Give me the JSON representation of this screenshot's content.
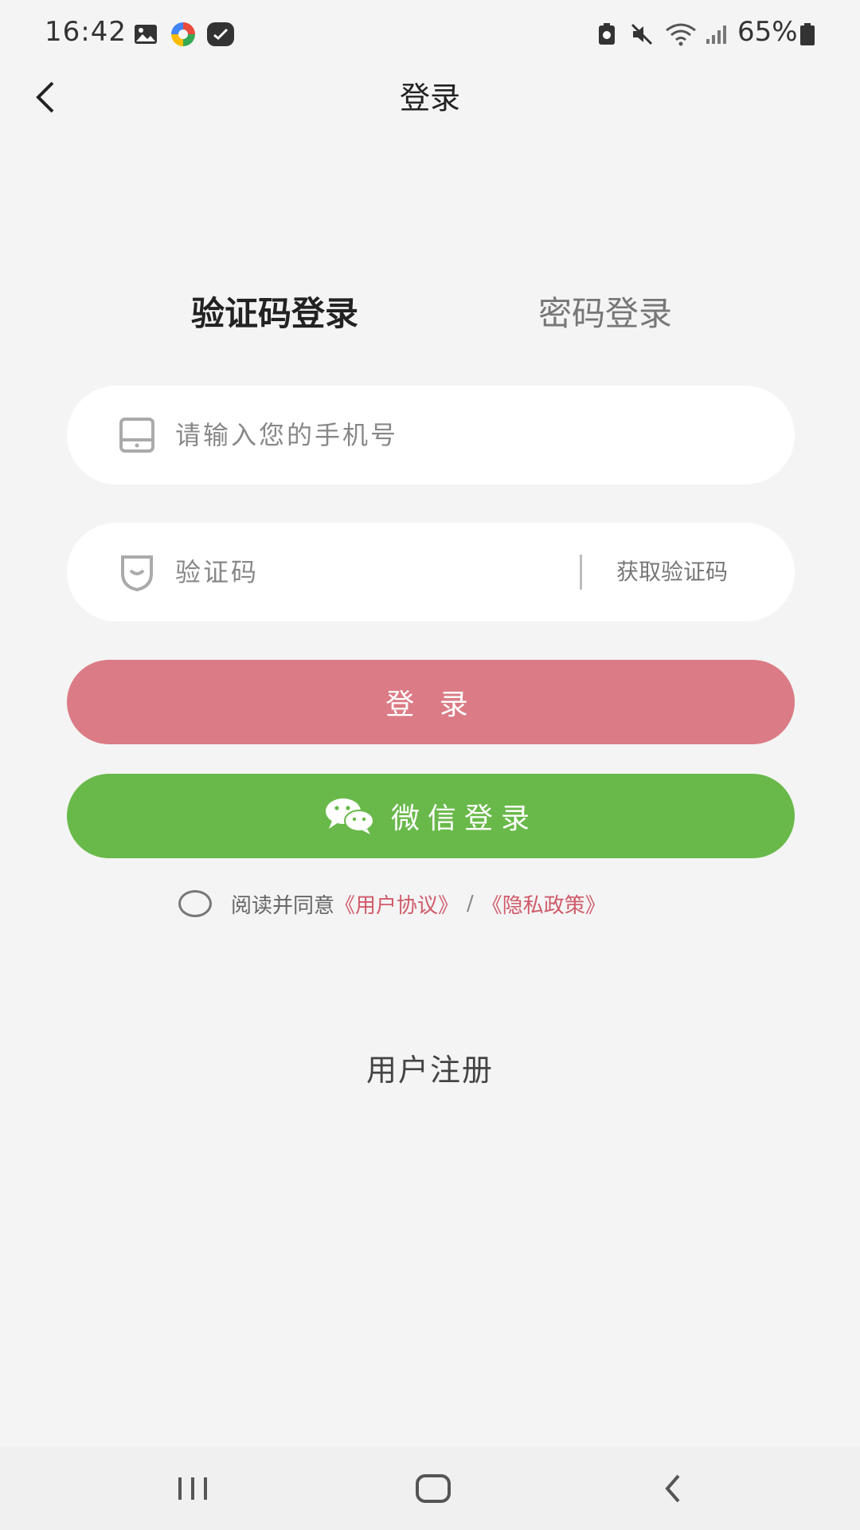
{
  "status_bar": {
    "time": "16:42",
    "battery_text": "65%",
    "icons": [
      "gallery-icon",
      "app-icon",
      "chat-app-icon",
      "battery-saver-icon",
      "mute-icon",
      "wifi-icon",
      "signal-icon",
      "battery-icon"
    ]
  },
  "header": {
    "title": "登录",
    "back_icon": "back-arrow-icon"
  },
  "tabs": {
    "active": "验证码登录",
    "inactive": "密码登录"
  },
  "phone_field": {
    "placeholder": "请输入您的手机号",
    "icon": "phone-icon"
  },
  "code_field": {
    "placeholder": "验证码",
    "icon": "shield-icon",
    "get_code_label": "获取验证码"
  },
  "buttons": {
    "login": "登 录",
    "wechat": "微信登录",
    "wechat_icon": "wechat-icon"
  },
  "agreement": {
    "prefix": "阅读并同意",
    "user_agreement": "《用户协议》",
    "separator": "/",
    "privacy_policy": "《隐私政策》"
  },
  "register": "用户注册",
  "colors": {
    "background": "#f4f4f4",
    "login_button": "#db7b85",
    "wechat_button": "#69b94a",
    "link": "#d05b6a"
  },
  "nav_bar": {
    "icons": [
      "recent-apps-icon",
      "home-icon",
      "back-icon"
    ]
  }
}
